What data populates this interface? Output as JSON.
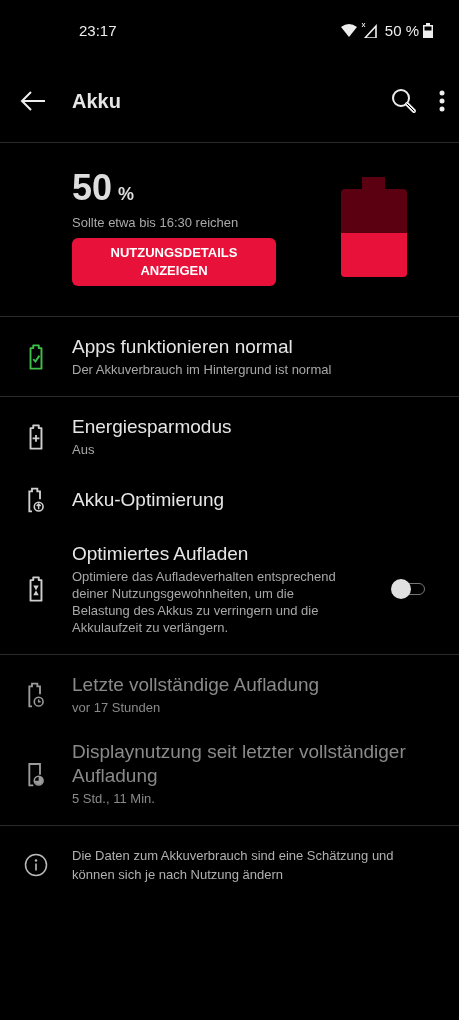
{
  "status_bar": {
    "time": "23:17",
    "battery_text": "50 %"
  },
  "toolbar": {
    "title": "Akku"
  },
  "summary": {
    "percent": "50",
    "percent_unit": "%",
    "estimate": "Sollte etwa bis 16:30 reichen",
    "button": "NUTZUNGSDETAILS ANZEIGEN"
  },
  "groups": [
    {
      "items": [
        {
          "title": "Apps funktionieren normal",
          "subtitle": "Der Akkuverbrauch im Hintergrund ist normal",
          "disabled": false
        }
      ]
    },
    {
      "items": [
        {
          "title": "Energiesparmodus",
          "subtitle": "Aus",
          "disabled": false
        },
        {
          "title": "Akku-Optimierung",
          "disabled": false
        },
        {
          "title": "Optimiertes Aufladen",
          "subtitle": "Optimiere das Aufladeverhalten entsprechend deiner Nutzungsgewohnheiten, um die Belastung des Akkus zu verringern und die Akkulaufzeit zu verlängern.",
          "disabled": false,
          "on": false
        }
      ]
    },
    {
      "items": [
        {
          "title": "Letzte vollständige Aufladung",
          "subtitle": "vor 17 Stunden",
          "disabled": true
        },
        {
          "title": "Displaynutzung seit letzter vollständiger Aufladung",
          "subtitle": "5 Std., 11 Min.",
          "disabled": true
        }
      ]
    }
  ],
  "footer": {
    "text": "Die Daten zum Akkuverbrauch sind eine Schätzung und können sich je nach Nutzung ändern"
  }
}
